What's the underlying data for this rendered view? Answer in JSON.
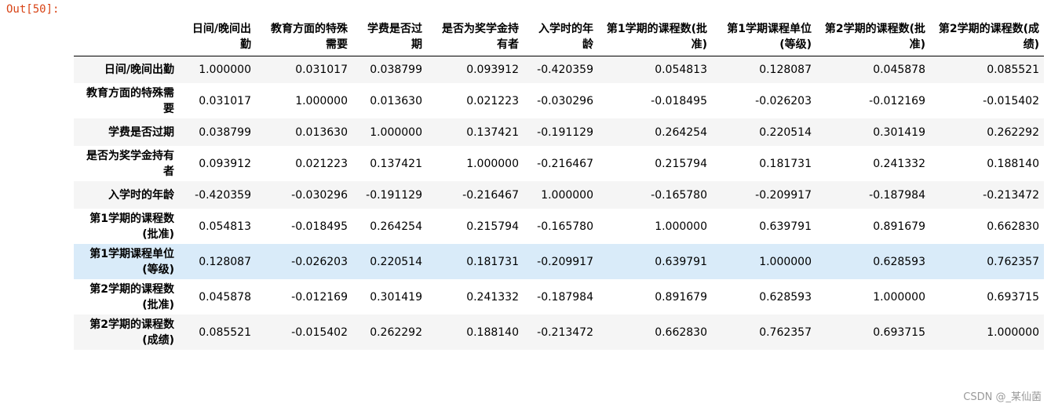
{
  "output_prompt": "Out[50]:",
  "columns": [
    "日间/晚间出勤",
    "教育方面的特殊需要",
    "学费是否过期",
    "是否为奖学金持有者",
    "入学时的年龄",
    "第1学期的课程数(批准)",
    "第1学期课程单位(等级)",
    "第2学期的课程数(批准)",
    "第2学期的课程数(成绩)"
  ],
  "rows": [
    {
      "label": "日间/晚间出勤",
      "values": [
        "1.000000",
        "0.031017",
        "0.038799",
        "0.093912",
        "-0.420359",
        "0.054813",
        "0.128087",
        "0.045878",
        "0.085521"
      ]
    },
    {
      "label": "教育方面的特殊需要",
      "values": [
        "0.031017",
        "1.000000",
        "0.013630",
        "0.021223",
        "-0.030296",
        "-0.018495",
        "-0.026203",
        "-0.012169",
        "-0.015402"
      ]
    },
    {
      "label": "学费是否过期",
      "values": [
        "0.038799",
        "0.013630",
        "1.000000",
        "0.137421",
        "-0.191129",
        "0.264254",
        "0.220514",
        "0.301419",
        "0.262292"
      ]
    },
    {
      "label": "是否为奖学金持有者",
      "values": [
        "0.093912",
        "0.021223",
        "0.137421",
        "1.000000",
        "-0.216467",
        "0.215794",
        "0.181731",
        "0.241332",
        "0.188140"
      ]
    },
    {
      "label": "入学时的年龄",
      "values": [
        "-0.420359",
        "-0.030296",
        "-0.191129",
        "-0.216467",
        "1.000000",
        "-0.165780",
        "-0.209917",
        "-0.187984",
        "-0.213472"
      ]
    },
    {
      "label": "第1学期的课程数(批准)",
      "values": [
        "0.054813",
        "-0.018495",
        "0.264254",
        "0.215794",
        "-0.165780",
        "1.000000",
        "0.639791",
        "0.891679",
        "0.662830"
      ]
    },
    {
      "label": "第1学期课程单位(等级)",
      "values": [
        "0.128087",
        "-0.026203",
        "0.220514",
        "0.181731",
        "-0.209917",
        "0.639791",
        "1.000000",
        "0.628593",
        "0.762357"
      ]
    },
    {
      "label": "第2学期的课程数(批准)",
      "values": [
        "0.045878",
        "-0.012169",
        "0.301419",
        "0.241332",
        "-0.187984",
        "0.891679",
        "0.628593",
        "1.000000",
        "0.693715"
      ]
    },
    {
      "label": "第2学期的课程数(成绩)",
      "values": [
        "0.085521",
        "-0.015402",
        "0.262292",
        "0.188140",
        "-0.213472",
        "0.662830",
        "0.762357",
        "0.693715",
        "1.000000"
      ]
    }
  ],
  "highlighted_row": 6,
  "colors": {
    "prompt": "#d84315",
    "row_stripe": "#f5f5f5",
    "row_hover": "#d9ebf9"
  },
  "watermark": "CSDN @_某仙菌"
}
